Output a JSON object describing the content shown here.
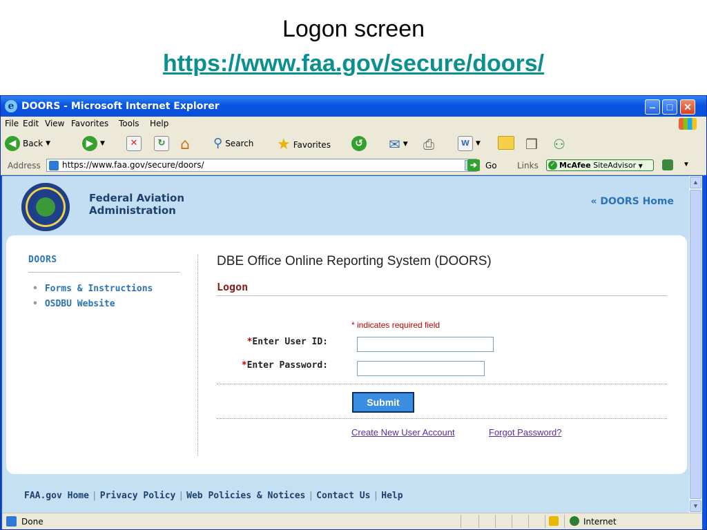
{
  "slide": {
    "title": "Logon screen",
    "url": "https://www.faa.gov/secure/doors/"
  },
  "window": {
    "title": "DOORS - Microsoft Internet Explorer",
    "controls": {
      "minimize": "‒",
      "maximize": "□",
      "close": "✕"
    }
  },
  "menu": {
    "items": [
      "File",
      "Edit",
      "View",
      "Favorites",
      "Tools",
      "Help"
    ]
  },
  "toolbar": {
    "back": "Back",
    "search": "Search",
    "favorites": "Favorites"
  },
  "address_bar": {
    "label": "Address",
    "value": "https://www.faa.gov/secure/doors/",
    "go": "Go",
    "links": "Links",
    "siteadvisor_brand": "McAfee",
    "siteadvisor_suffix": "SiteAdvisor"
  },
  "header": {
    "org_line1": "Federal Aviation",
    "org_line2": "Administration",
    "home_link": "« DOORS Home"
  },
  "sidebar": {
    "title": "DOORS",
    "links": [
      "Forms & Instructions",
      "OSDBU Website"
    ]
  },
  "main": {
    "title": "DBE Office Online Reporting System (DOORS)",
    "section": "Logon",
    "required_note": "* indicates required field",
    "userid_label": "Enter User ID:",
    "password_label": "Enter Password:",
    "required_mark": "*",
    "submit": "Submit",
    "create_account": "Create New User Account",
    "forgot_password": "Forgot Password?"
  },
  "footer": {
    "links": [
      "FAA.gov Home",
      "Privacy Policy",
      "Web Policies & Notices",
      "Contact Us",
      "Help"
    ],
    "separator": "|"
  },
  "status_bar": {
    "status": "Done",
    "zone": "Internet"
  },
  "colors": {
    "xp_blue": "#0a54e3",
    "link_blue": "#2a73b8",
    "logon_red": "#8a1a1a",
    "submit_blue": "#3a8de0",
    "header_bg": "#c3def2"
  },
  "icons": [
    "ie-logo-icon",
    "back-icon",
    "forward-icon",
    "stop-icon",
    "refresh-icon",
    "home-icon",
    "search-icon",
    "favorites-star-icon",
    "history-icon",
    "mail-icon",
    "print-icon",
    "edit-icon",
    "folder-icon",
    "research-icon",
    "messenger-icon",
    "windows-flag-icon",
    "lock-icon",
    "globe-icon"
  ]
}
